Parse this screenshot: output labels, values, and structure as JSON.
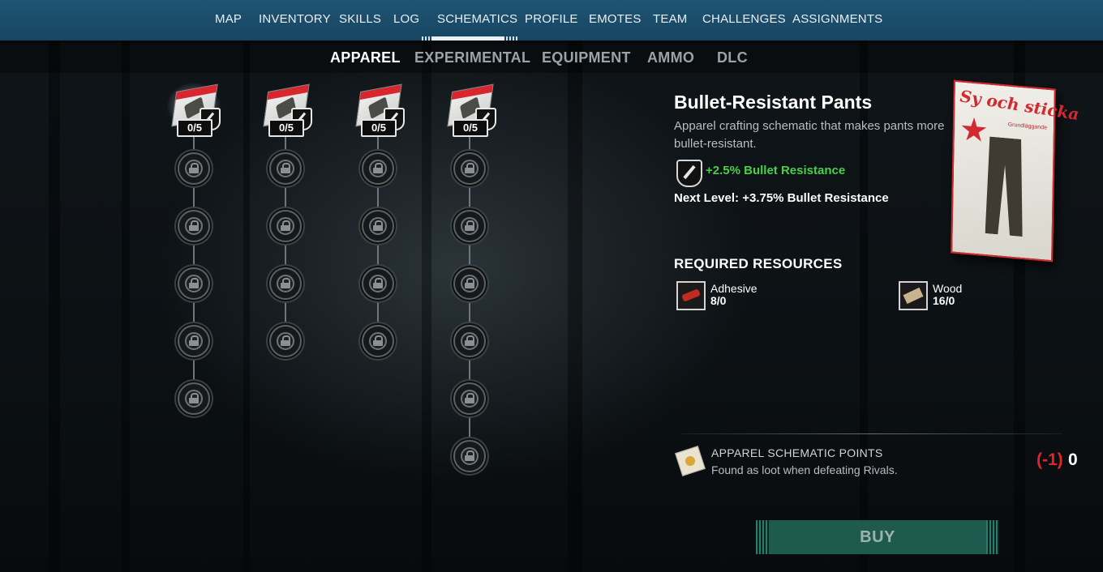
{
  "topnav": {
    "items": [
      "MAP",
      "INVENTORY",
      "SKILLS",
      "LOG",
      "SCHEMATICS",
      "PROFILE",
      "EMOTES",
      "TEAM",
      "CHALLENGES",
      "ASSIGNMENTS"
    ],
    "active": "SCHEMATICS"
  },
  "subtabs": {
    "items": [
      "APPAREL",
      "EXPERIMENTAL",
      "EQUIPMENT",
      "AMMO",
      "DLC"
    ],
    "active": "APPAREL"
  },
  "tree": {
    "columns": [
      {
        "top_count": "0/5",
        "locked_nodes": 5
      },
      {
        "top_count": "0/5",
        "locked_nodes": 4
      },
      {
        "top_count": "0/5",
        "locked_nodes": 4
      },
      {
        "top_count": "0/5",
        "locked_nodes": 6
      }
    ]
  },
  "detail": {
    "title": "Bullet-Resistant Pants",
    "description": "Apparel crafting schematic that makes pants more bullet-resistant.",
    "stat": "+2.5% Bullet Resistance",
    "next_label": "Next Level:",
    "next_value": "+3.75% Bullet Resistance",
    "pack_title": "Sy och sticka",
    "pack_subtitle": "Grundläggande"
  },
  "resources": {
    "title": "REQUIRED RESOURCES",
    "items": [
      {
        "name": "Adhesive",
        "count": "8/0",
        "icon": "adhesive-icon"
      },
      {
        "name": "Wood",
        "count": "16/0",
        "icon": "wood-icon"
      }
    ]
  },
  "points": {
    "title": "APPAREL SCHEMATIC POINTS",
    "description": "Found as loot when defeating Rivals.",
    "cost": "(-1)",
    "value": "0"
  },
  "buy_label": "BUY",
  "colors": {
    "nav_bg": "#1f5573",
    "stat_green": "#49d04a",
    "cost_red": "#e0262a",
    "buy_bg": "#1f5a4f"
  }
}
